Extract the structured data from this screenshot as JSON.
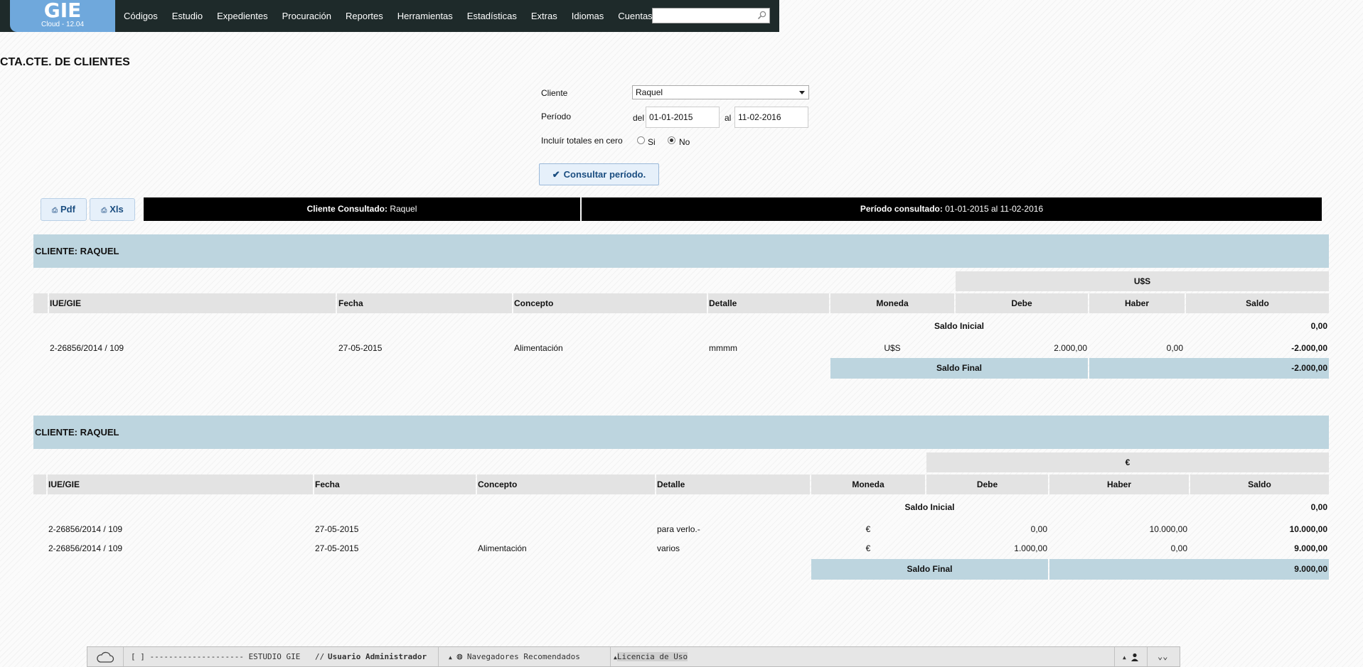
{
  "app": {
    "logo": "GIE",
    "version": "Cloud  - 12.04"
  },
  "nav": [
    "Códigos",
    "Estudio",
    "Expedientes",
    "Procuración",
    "Reportes",
    "Herramientas",
    "Estadísticas",
    "Extras",
    "Idiomas",
    "Cuentas"
  ],
  "search": {
    "value": "",
    "placeholder": ""
  },
  "page_title": "CTA.CTE. DE CLIENTES",
  "form": {
    "cliente_label": "Cliente",
    "cliente_value": "Raquel",
    "periodo_label": "Período",
    "del_label": "del",
    "del_value": "01-01-2015",
    "al_label": "al",
    "al_value": "11-02-2016",
    "totales_label": "Incluír totales en cero",
    "si_label": "Si",
    "no_label": "No",
    "consultar_label": "Consultar período."
  },
  "export": {
    "pdf": "Pdf",
    "xls": "Xls"
  },
  "info": {
    "cliente_label": "Cliente Consultado:",
    "cliente_value": "Raquel",
    "periodo_label": "Período consultado:",
    "periodo_value": "01-01-2015 al 11-02-2016"
  },
  "columns": {
    "iue": "IUE/GIE",
    "fecha": "Fecha",
    "concepto": "Concepto",
    "detalle": "Detalle",
    "moneda": "Moneda",
    "debe": "Debe",
    "haber": "Haber",
    "saldo": "Saldo"
  },
  "labels": {
    "saldo_inicial": "Saldo Inicial",
    "saldo_final": "Saldo Final"
  },
  "sections": [
    {
      "cliente_label": "CLIENTE:",
      "cliente_name": "RAQUEL",
      "currency": "U$S",
      "saldo_inicial": "0,00",
      "rows": [
        {
          "iue": "2-26856/2014 / 109",
          "fecha": "27-05-2015",
          "concepto": "Alimentación",
          "detalle": "mmmm",
          "moneda": "U$S",
          "debe": "2.000,00",
          "haber": "0,00",
          "saldo": "-2.000,00"
        }
      ],
      "saldo_final": "-2.000,00"
    },
    {
      "cliente_label": "CLIENTE:",
      "cliente_name": "RAQUEL",
      "currency": "€",
      "saldo_inicial": "0,00",
      "rows": [
        {
          "iue": "2-26856/2014 / 109",
          "fecha": "27-05-2015",
          "concepto": "",
          "detalle": "para verlo.-",
          "moneda": "€",
          "debe": "0,00",
          "haber": "10.000,00",
          "saldo": "10.000,00"
        },
        {
          "iue": "2-26856/2014 / 109",
          "fecha": "27-05-2015",
          "concepto": "Alimentación",
          "detalle": "varios",
          "moneda": "€",
          "debe": "1.000,00",
          "haber": "0,00",
          "saldo": "9.000,00"
        }
      ],
      "saldo_final": "9.000,00"
    }
  ],
  "footer": {
    "studio": "[ ] -------------------- ESTUDIO GIE",
    "slashes": "//",
    "user": "Usuario Administrador",
    "browsers": "Navegadores Recomendados",
    "license": "Licencia de Uso"
  }
}
